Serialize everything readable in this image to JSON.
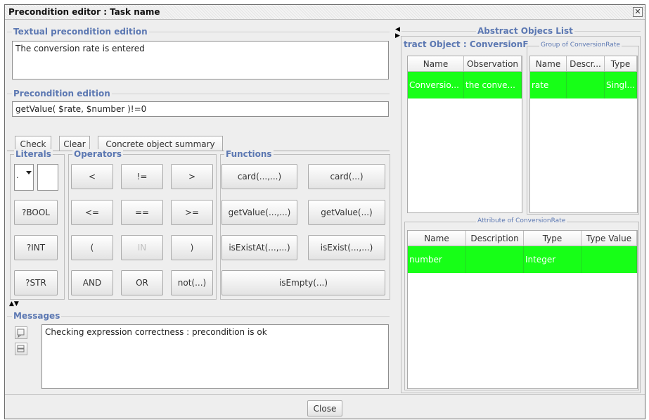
{
  "window": {
    "title": "Precondition editor : Task name",
    "close_icon": "close-x-icon"
  },
  "textual": {
    "title": "Textual precondition edition",
    "value": "The conversion rate is entered"
  },
  "precondition": {
    "title": "Precondition edition",
    "value": "getValue(  $rate, $number )!=0"
  },
  "tabs": [
    "Check",
    "Clear",
    "Concrete object summary"
  ],
  "groups": {
    "literals": "Literals",
    "operators": "Operators",
    "functions": "Functions"
  },
  "literals": {
    "combo_value": ".",
    "buttons": [
      "?BOOL",
      "?INT",
      "?STR"
    ]
  },
  "operators": [
    "<",
    "!=",
    ">",
    "<=",
    "==",
    ">=",
    "(",
    "IN",
    ")",
    "AND",
    "OR",
    "not(...)"
  ],
  "functions": [
    "card(...,...)",
    "card(...)",
    "getValue(...,...)",
    "getValue(...)",
    "isExistAt(...,...)",
    "isExist(...,...)",
    "isEmpty(...)"
  ],
  "messages": {
    "title": "Messages",
    "text": "Checking expression correctness : precondition is ok",
    "icons": [
      "message-icon",
      "database-icon"
    ]
  },
  "abstract_list": {
    "title": "Abstract Objecs List",
    "object_title": "tract Object : ConversionF",
    "object_table": {
      "columns": [
        "Name",
        "Observation"
      ],
      "rows": [
        [
          "Conversio...",
          "the conve..."
        ]
      ]
    },
    "group_title": "Group of ConversionRate",
    "group_table": {
      "columns": [
        "Name",
        "Descr...",
        "Type"
      ],
      "rows": [
        [
          "rate",
          "",
          "Singl..."
        ]
      ]
    },
    "attribute_title": "Attribute of ConversionRate",
    "attribute_table": {
      "columns": [
        "Name",
        "Description",
        "Type",
        "Type Value"
      ],
      "rows": [
        [
          "number",
          "",
          "Integer",
          ""
        ]
      ]
    }
  },
  "footer": {
    "close_label": "Close"
  },
  "colors": {
    "section_title": "#5c78b2",
    "selected_row": "#17ff17"
  }
}
